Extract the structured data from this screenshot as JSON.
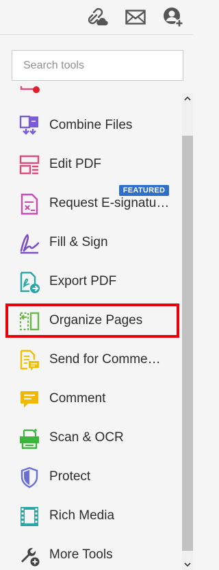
{
  "top_bar": {
    "icons": [
      "cloud-link-icon",
      "mail-icon",
      "user-add-icon"
    ]
  },
  "search": {
    "placeholder": "Search tools"
  },
  "tools": [
    {
      "label": "Combine Files",
      "icon": "combine-files-icon",
      "color": "#7b5cd6"
    },
    {
      "label": "Edit PDF",
      "icon": "edit-pdf-icon",
      "color": "#e0497a"
    },
    {
      "label": "Request E-signatu…",
      "icon": "request-esignature-icon",
      "color": "#c94bb0"
    },
    {
      "label": "Fill & Sign",
      "icon": "fill-sign-icon",
      "color": "#7a4fc4"
    },
    {
      "label": "Export PDF",
      "icon": "export-pdf-icon",
      "color": "#2aa6a6"
    },
    {
      "label": "Organize Pages",
      "icon": "organize-pages-icon",
      "color": "#6ab646"
    },
    {
      "label": "Send for Comme…",
      "icon": "send-for-comment-icon",
      "color": "#f0c000"
    },
    {
      "label": "Comment",
      "icon": "comment-icon",
      "color": "#f0b800"
    },
    {
      "label": "Scan & OCR",
      "icon": "scan-ocr-icon",
      "color": "#3cb53c"
    },
    {
      "label": "Protect",
      "icon": "protect-icon",
      "color": "#6a6fd8"
    },
    {
      "label": "Rich Media",
      "icon": "rich-media-icon",
      "color": "#2aa6a6"
    },
    {
      "label": "More Tools",
      "icon": "more-tools-icon",
      "color": "#444444"
    }
  ],
  "badge": {
    "text": "FEATURED",
    "color": "#2d6fc8"
  },
  "highlight": {
    "target": "Organize Pages",
    "color": "#e8000b"
  }
}
